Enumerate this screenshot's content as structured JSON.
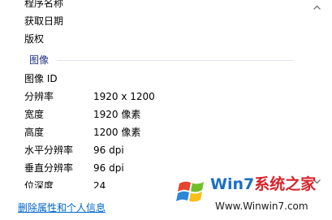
{
  "details": {
    "rows": [
      {
        "name": "程序名称",
        "value": ""
      },
      {
        "name": "获取日期",
        "value": ""
      },
      {
        "name": "版权",
        "value": ""
      }
    ],
    "image_group": {
      "header": "图像",
      "rows": [
        {
          "name": "图像 ID",
          "value": ""
        },
        {
          "name": "分辨率",
          "value": "1920 x 1200"
        },
        {
          "name": "宽度",
          "value": "1920 像素"
        },
        {
          "name": "高度",
          "value": "1200 像素"
        },
        {
          "name": "水平分辨率",
          "value": "96 dpi"
        },
        {
          "name": "垂直分辨率",
          "value": "96 dpi"
        },
        {
          "name": "位深度",
          "value": "24"
        }
      ]
    }
  },
  "footer": {
    "remove_link": "删除属性和个人信息"
  },
  "watermark": {
    "title_part1": "Win7",
    "title_part2": "系统之家",
    "url": "Www.Winwin7.com"
  },
  "colors": {
    "group_header": "#1e3287",
    "link": "#0066cc",
    "watermark_blue": "#1b6fc2",
    "watermark_red": "#d8232a"
  },
  "icons": {
    "scroll_up": "chevron-up-icon",
    "scroll_down": "chevron-down-icon",
    "watermark_logo": "windows-logo-icon"
  }
}
